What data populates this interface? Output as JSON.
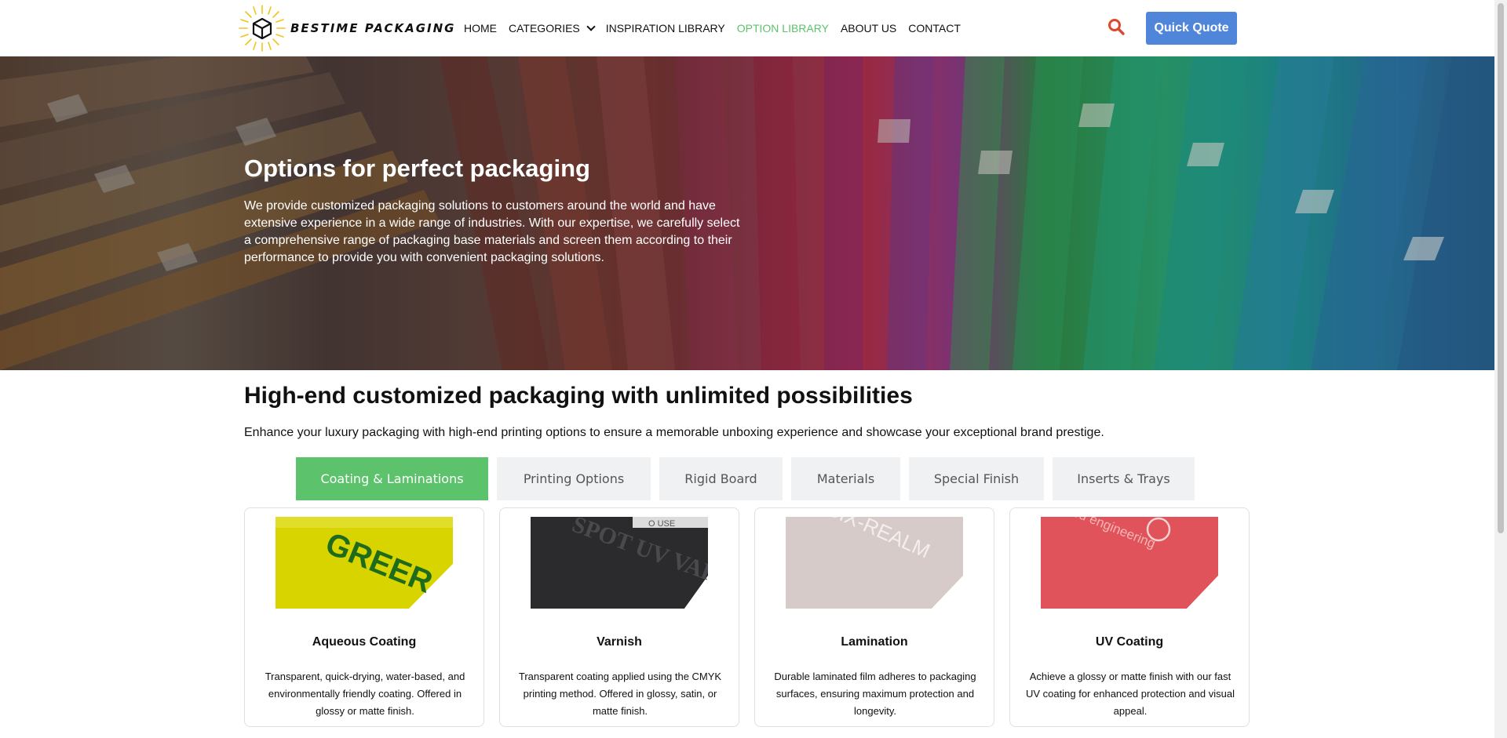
{
  "brand": {
    "name": "BESTIME PACKAGING",
    "logo_icon": "sunburst-cube-icon"
  },
  "nav": {
    "items": [
      {
        "label": "HOME"
      },
      {
        "label": "CATEGORIES"
      },
      {
        "label": "INSPIRATION LIBRARY"
      },
      {
        "label": "OPTION LIBRARY"
      },
      {
        "label": "ABOUT US"
      },
      {
        "label": "CONTACT"
      }
    ],
    "search_icon": "search-icon",
    "quote_label": "Quick Quote"
  },
  "hero": {
    "title": "Options for perfect packaging",
    "text": "We provide customized packaging solutions to customers around the world and have extensive experience in a wide range of industries. With our expertise, we carefully select a comprehensive range of packaging base materials and screen them according to their performance to provide you with convenient packaging solutions."
  },
  "section": {
    "title": "High-end customized packaging with unlimited possibilities",
    "subtitle": "Enhance your luxury packaging with high-end printing options to ensure a memorable unboxing experience and showcase your exceptional brand prestige."
  },
  "tabs": [
    {
      "label": "Coating & Laminations"
    },
    {
      "label": "Printing Options"
    },
    {
      "label": "Rigid Board"
    },
    {
      "label": "Materials"
    },
    {
      "label": "Special Finish"
    },
    {
      "label": "Inserts & Trays"
    }
  ],
  "cards": [
    {
      "title": "Aqueous Coating",
      "text": "Transparent, quick-drying, water-based, and environmentally friendly coating. Offered in glossy or matte finish.",
      "image_text": "GREER"
    },
    {
      "title": "Varnish",
      "text": "Transparent coating applied using the CMYK printing method. Offered in glossy, satin, or matte finish.",
      "image_text": "SPOT UV VARNISH",
      "image_text_top": "O USE"
    },
    {
      "title": "Lamination",
      "text": "Durable laminated film adheres to packaging surfaces, ensuring maximum protection and longevity.",
      "image_text": "SIX-REALM"
    },
    {
      "title": "UV Coating",
      "text": "Achieve a glossy or matte finish with our fast UV coating for enhanced protection and visual appeal.",
      "image_text": "red engineering"
    }
  ],
  "colors": {
    "accent_green": "#5cc26b",
    "button_blue": "#4f86d9",
    "search_red": "#e0462e"
  }
}
